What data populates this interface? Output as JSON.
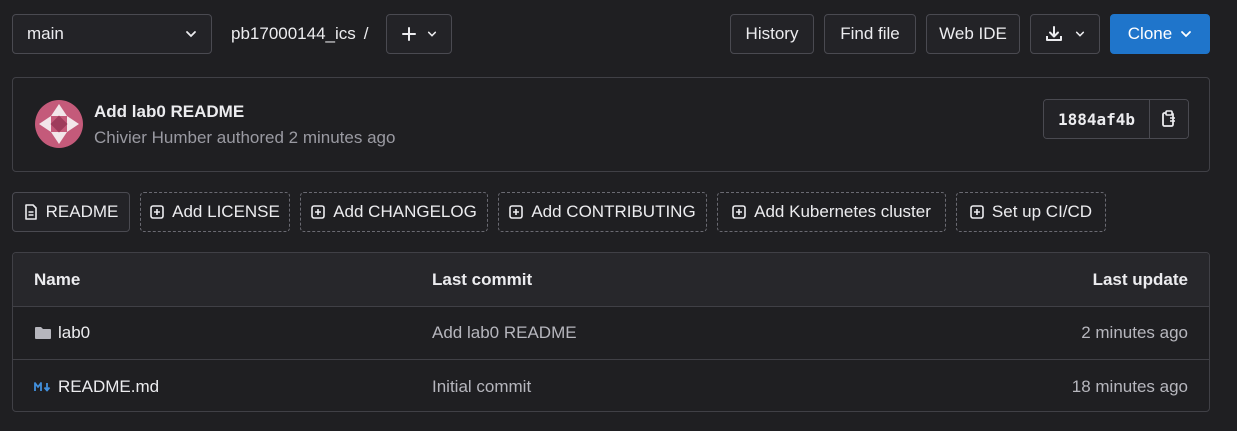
{
  "topbar": {
    "branch": "main",
    "project": "pb17000144_ics",
    "separator": "/",
    "history_label": "History",
    "find_file_label": "Find file",
    "web_ide_label": "Web IDE",
    "clone_label": "Clone"
  },
  "commit": {
    "title": "Add lab0 README",
    "meta": "Chivier Humber authored 2 minutes ago",
    "sha": "1884af4b"
  },
  "actions": {
    "readme": "README",
    "license": "Add LICENSE",
    "changelog": "Add CHANGELOG",
    "contributing": "Add CONTRIBUTING",
    "kubernetes": "Add Kubernetes cluster",
    "cicd": "Set up CI/CD"
  },
  "table": {
    "headers": {
      "name": "Name",
      "last_commit": "Last commit",
      "last_update": "Last update"
    },
    "rows": [
      {
        "name": "lab0",
        "icon": "folder-icon",
        "last_commit": "Add lab0 README",
        "last_update": "2 minutes ago"
      },
      {
        "name": "README.md",
        "icon": "markdown-icon",
        "last_commit": "Initial commit",
        "last_update": "18 minutes ago"
      }
    ]
  },
  "colors": {
    "accent": "#1f75cb",
    "background": "#1f1f22",
    "markdown_icon": "#428fdc"
  }
}
